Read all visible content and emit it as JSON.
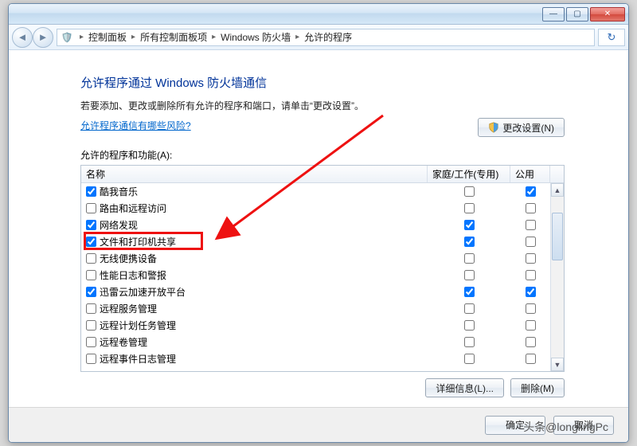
{
  "titlebar": {
    "min": "—",
    "max": "▢",
    "close": "✕"
  },
  "nav": {
    "back": "◄",
    "fwd": "►",
    "icon": "🛡️",
    "crumbs": [
      "控制面板",
      "所有控制面板项",
      "Windows 防火墙",
      "允许的程序"
    ],
    "refresh": "↻"
  },
  "page": {
    "title": "允许程序通过 Windows 防火墙通信",
    "subtitle": "若要添加、更改或删除所有允许的程序和端口，请单击“更改设置”。",
    "risk_link": "允许程序通信有哪些风险?",
    "change_btn": "更改设置(N)",
    "caption": "允许的程序和功能(A):"
  },
  "table": {
    "head_name": "名称",
    "head_home": "家庭/工作(专用)",
    "head_public": "公用",
    "rows": [
      {
        "name": "酷我音乐",
        "sel": true,
        "home": false,
        "pub": true
      },
      {
        "name": "路由和远程访问",
        "sel": false,
        "home": false,
        "pub": false
      },
      {
        "name": "网络发现",
        "sel": true,
        "home": true,
        "pub": false
      },
      {
        "name": "文件和打印机共享",
        "sel": true,
        "home": true,
        "pub": false
      },
      {
        "name": "无线便携设备",
        "sel": false,
        "home": false,
        "pub": false
      },
      {
        "name": "性能日志和警报",
        "sel": false,
        "home": false,
        "pub": false
      },
      {
        "name": "迅雷云加速开放平台",
        "sel": true,
        "home": true,
        "pub": true
      },
      {
        "name": "远程服务管理",
        "sel": false,
        "home": false,
        "pub": false
      },
      {
        "name": "远程计划任务管理",
        "sel": false,
        "home": false,
        "pub": false
      },
      {
        "name": "远程卷管理",
        "sel": false,
        "home": false,
        "pub": false
      },
      {
        "name": "远程事件日志管理",
        "sel": false,
        "home": false,
        "pub": false
      }
    ],
    "details_btn": "详细信息(L)...",
    "delete_btn": "删除(M)"
  },
  "footer": {
    "ok": "确定",
    "cancel": "取消"
  },
  "watermark": "头条@longlingPc",
  "highlight_row_index": 3
}
